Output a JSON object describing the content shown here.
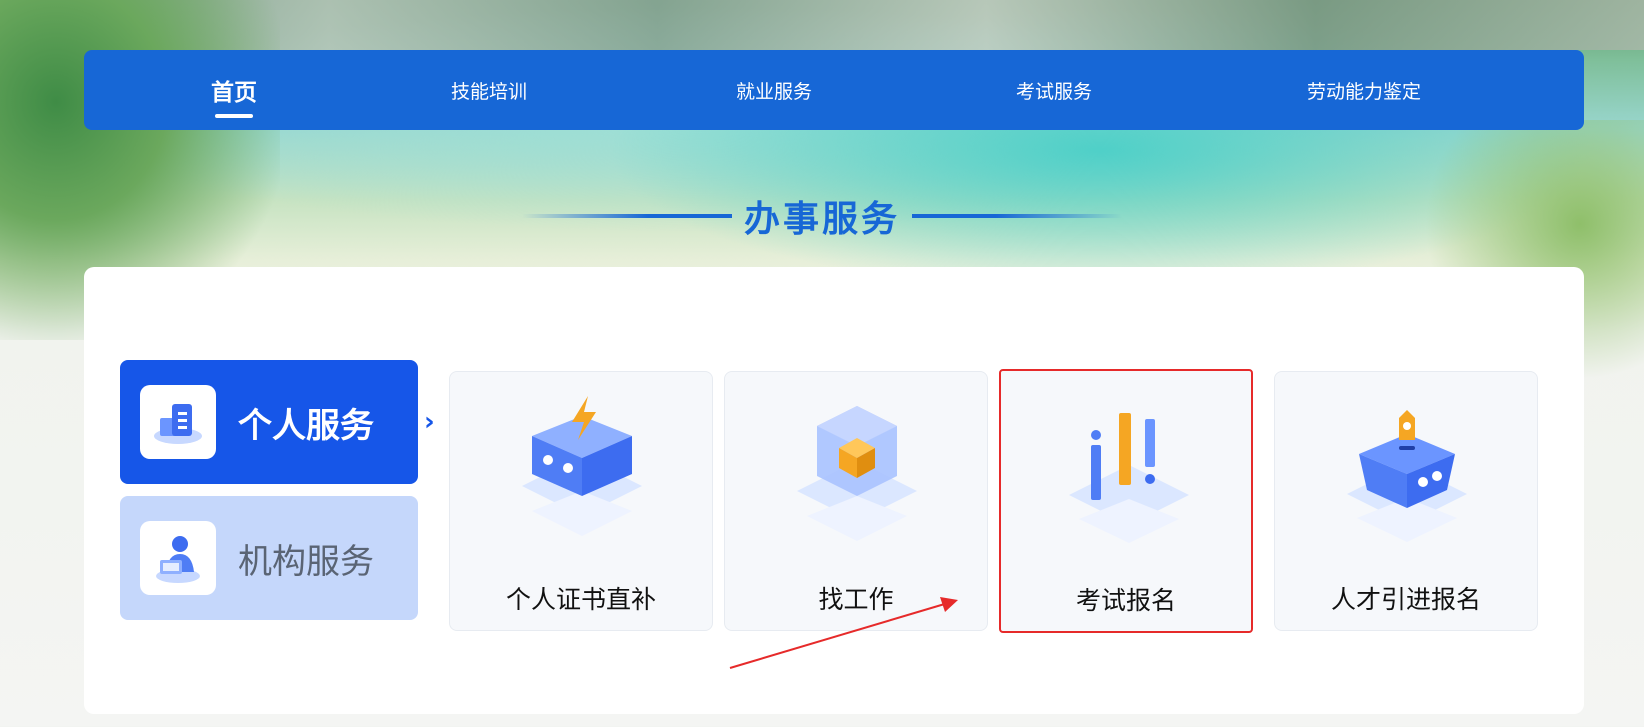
{
  "nav": {
    "items": [
      {
        "label": "首页",
        "active": true
      },
      {
        "label": "技能培训",
        "active": false
      },
      {
        "label": "就业服务",
        "active": false
      },
      {
        "label": "考试服务",
        "active": false
      },
      {
        "label": "劳动能力鉴定",
        "active": false
      }
    ]
  },
  "section": {
    "title": "办事服务"
  },
  "categories": [
    {
      "label": "个人服务",
      "active": true
    },
    {
      "label": "机构服务",
      "active": false
    }
  ],
  "services": [
    {
      "label": "个人证书直补"
    },
    {
      "label": "找工作"
    },
    {
      "label": "考试报名",
      "highlighted": true
    },
    {
      "label": "人才引进报名"
    }
  ],
  "colors": {
    "nav_bg": "#1767d6",
    "primary_blue": "#1656e8",
    "inactive_category_bg": "#c5d7fb",
    "highlight_red": "#e62a2a",
    "accent_orange": "#f5a623"
  }
}
